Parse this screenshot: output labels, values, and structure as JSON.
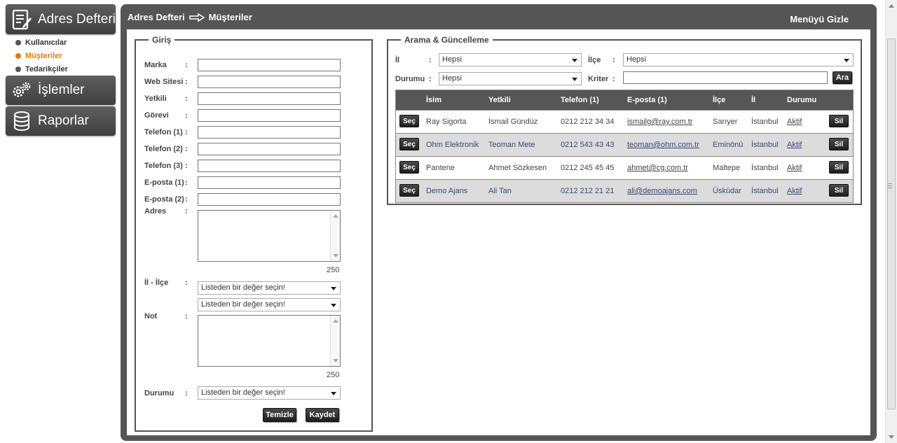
{
  "sidebar": {
    "adres_defteri": "Adres Defteri",
    "sub_items": [
      "Kullanıcılar",
      "Müşteriler",
      "Tedarikçiler"
    ],
    "islemler": "İşlemler",
    "raporlar": "Raporlar"
  },
  "header": {
    "crumb_root": "Adres Defteri",
    "crumb_current": "Müşteriler",
    "hide_menu": "Menüyü Gizle"
  },
  "giris": {
    "legend": "Giriş",
    "colon": ":",
    "fields": {
      "marka": "Marka",
      "web": "Web Sitesi",
      "yetkili": "Yetkili",
      "gorevi": "Görevi",
      "tel1": "Telefon (1)",
      "tel2": "Telefon (2)",
      "tel3": "Telefon (3)",
      "eposta1": "E-posta (1)",
      "eposta2": "E-posta (2)",
      "adres": "Adres",
      "il_ilce": "İl - İlçe",
      "not": "Not",
      "durumu": "Durumu"
    },
    "adres_counter": "250",
    "not_counter": "250",
    "select_placeholder": "Listeden bir değer seçin!",
    "temizle": "Temizle",
    "kaydet": "Kaydet"
  },
  "arama": {
    "legend": "Arama & Güncelleme",
    "il_label": "İl",
    "ilce_label": "İlçe",
    "durumu_label": "Durumu",
    "kriter_label": "Kriter",
    "colon": ":",
    "il_value": "Hepsi",
    "ilce_value": "Hepsi",
    "durumu_value": "Hepsi",
    "ara": "Ara"
  },
  "table": {
    "headers": [
      "İsim",
      "Yetkili",
      "Telefon (1)",
      "E-posta (1)",
      "İlçe",
      "İl",
      "Durumu"
    ],
    "sec": "Seç",
    "sil": "Sil",
    "rows": [
      {
        "isim": "Ray Sigorta",
        "yetkili": "İsmail Gündüz",
        "tel": "0212 212 34 34",
        "eposta": "ismailg@ray.com.tr",
        "ilce": "Sarıyer",
        "il": "İstanbul",
        "durum": "Aktif"
      },
      {
        "isim": "Ohm Elektronik",
        "yetkili": "Teoman Mete",
        "tel": "0212 543 43 43",
        "eposta": "teoman@ohm.com.tr",
        "ilce": "Eminönü",
        "il": "İstanbul",
        "durum": "Aktif"
      },
      {
        "isim": "Pantene",
        "yetkili": "Ahmet Sözkesen",
        "tel": "0212 245 45 45",
        "eposta": "ahmet@cg.com.tr",
        "ilce": "Maltepe",
        "il": "İstanbul",
        "durum": "Aktif"
      },
      {
        "isim": "Demo Ajans",
        "yetkili": "Ali Tan",
        "tel": "0212 212 21 21",
        "eposta": "ali@demoajans.com",
        "ilce": "Üsküdar",
        "il": "İstanbul",
        "durum": "Aktif"
      }
    ]
  }
}
